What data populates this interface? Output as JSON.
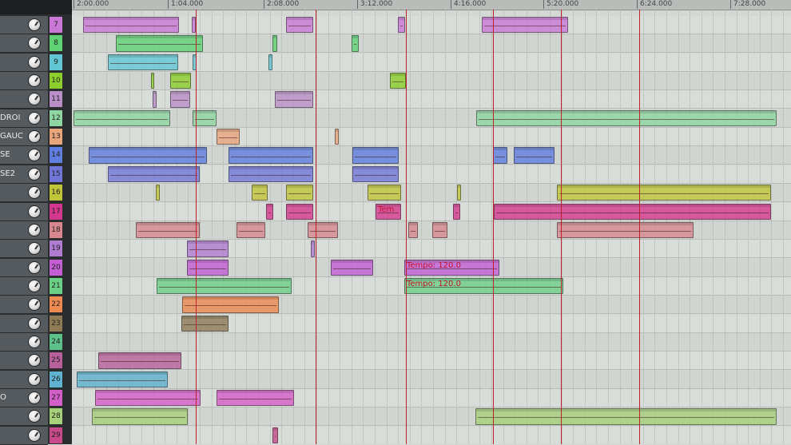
{
  "ruler": {
    "labels": [
      "2:00.000",
      "1:04.000",
      "2:08.000",
      "3:12.000",
      "4:16.000",
      "5:20.000",
      "6:24.000",
      "7:28.000"
    ]
  },
  "tracks": [
    {
      "num": "7",
      "name": "",
      "color": "#c978d6"
    },
    {
      "num": "8",
      "name": "",
      "color": "#5fd276"
    },
    {
      "num": "9",
      "name": "",
      "color": "#62c7d3"
    },
    {
      "num": "10",
      "name": "",
      "color": "#8ccf2a"
    },
    {
      "num": "11",
      "name": "",
      "color": "#b98ec8"
    },
    {
      "num": "12",
      "name": "DROI",
      "color": "#8ed7a2"
    },
    {
      "num": "13",
      "name": "GAUC",
      "color": "#e8a47a"
    },
    {
      "num": "14",
      "name": "SE",
      "color": "#5f7ee0"
    },
    {
      "num": "15",
      "name": "SE2",
      "color": "#6f76d8"
    },
    {
      "num": "16",
      "name": "",
      "color": "#c0c63a"
    },
    {
      "num": "17",
      "name": "",
      "color": "#d4388e"
    },
    {
      "num": "18",
      "name": "",
      "color": "#d7888e"
    },
    {
      "num": "19",
      "name": "",
      "color": "#b07cd2"
    },
    {
      "num": "20",
      "name": "",
      "color": "#c35ed4"
    },
    {
      "num": "21",
      "name": "",
      "color": "#6bcf86"
    },
    {
      "num": "22",
      "name": "",
      "color": "#ee8a52"
    },
    {
      "num": "23",
      "name": "",
      "color": "#8f7a56"
    },
    {
      "num": "24",
      "name": "",
      "color": "#5ec18a"
    },
    {
      "num": "25",
      "name": "",
      "color": "#b7609a"
    },
    {
      "num": "26",
      "name": "",
      "color": "#5fb3d0"
    },
    {
      "num": "27",
      "name": "O",
      "color": "#d45ec8"
    },
    {
      "num": "28",
      "name": "",
      "color": "#a6d07a"
    },
    {
      "num": "29",
      "name": "",
      "color": "#c84a8a"
    }
  ],
  "items": [
    {
      "row": 0,
      "start": 104,
      "end": 224,
      "label": ""
    },
    {
      "row": 0,
      "start": 240,
      "end": 245,
      "label": ""
    },
    {
      "row": 0,
      "start": 358,
      "end": 392,
      "label": ""
    },
    {
      "row": 0,
      "start": 498,
      "end": 507,
      "label": ""
    },
    {
      "row": 0,
      "start": 603,
      "end": 711,
      "label": ""
    },
    {
      "row": 1,
      "start": 145,
      "end": 254,
      "label": ""
    },
    {
      "row": 1,
      "start": 341,
      "end": 347,
      "label": ""
    },
    {
      "row": 1,
      "start": 440,
      "end": 449,
      "label": ""
    },
    {
      "row": 2,
      "start": 135,
      "end": 223,
      "label": ""
    },
    {
      "row": 2,
      "start": 241,
      "end": 246,
      "label": ""
    },
    {
      "row": 2,
      "start": 336,
      "end": 341,
      "label": ""
    },
    {
      "row": 3,
      "start": 189,
      "end": 193,
      "label": ""
    },
    {
      "row": 3,
      "start": 213,
      "end": 239,
      "label": ""
    },
    {
      "row": 3,
      "start": 488,
      "end": 508,
      "label": ""
    },
    {
      "row": 4,
      "start": 191,
      "end": 196,
      "label": ""
    },
    {
      "row": 4,
      "start": 213,
      "end": 238,
      "label": ""
    },
    {
      "row": 4,
      "start": 344,
      "end": 392,
      "label": ""
    },
    {
      "row": 5,
      "start": 92,
      "end": 213,
      "label": ""
    },
    {
      "row": 5,
      "start": 241,
      "end": 271,
      "label": ""
    },
    {
      "row": 5,
      "start": 596,
      "end": 972,
      "label": ""
    },
    {
      "row": 6,
      "start": 271,
      "end": 300,
      "label": ""
    },
    {
      "row": 6,
      "start": 419,
      "end": 424,
      "label": ""
    },
    {
      "row": 7,
      "start": 111,
      "end": 259,
      "label": ""
    },
    {
      "row": 7,
      "start": 286,
      "end": 392,
      "label": ""
    },
    {
      "row": 7,
      "start": 441,
      "end": 499,
      "label": ""
    },
    {
      "row": 7,
      "start": 617,
      "end": 635,
      "label": ""
    },
    {
      "row": 7,
      "start": 643,
      "end": 694,
      "label": ""
    },
    {
      "row": 8,
      "start": 135,
      "end": 250,
      "label": ""
    },
    {
      "row": 8,
      "start": 286,
      "end": 392,
      "label": ""
    },
    {
      "row": 8,
      "start": 441,
      "end": 499,
      "label": ""
    },
    {
      "row": 9,
      "start": 195,
      "end": 200,
      "label": ""
    },
    {
      "row": 9,
      "start": 315,
      "end": 335,
      "label": ""
    },
    {
      "row": 9,
      "start": 358,
      "end": 392,
      "label": ""
    },
    {
      "row": 9,
      "start": 460,
      "end": 502,
      "label": ""
    },
    {
      "row": 9,
      "start": 572,
      "end": 577,
      "label": ""
    },
    {
      "row": 9,
      "start": 697,
      "end": 965,
      "label": ""
    },
    {
      "row": 10,
      "start": 333,
      "end": 342,
      "label": ""
    },
    {
      "row": 10,
      "start": 358,
      "end": 392,
      "label": ""
    },
    {
      "row": 10,
      "start": 470,
      "end": 502,
      "label": "Tem"
    },
    {
      "row": 10,
      "start": 567,
      "end": 576,
      "label": ""
    },
    {
      "row": 10,
      "start": 618,
      "end": 965,
      "label": ""
    },
    {
      "row": 11,
      "start": 170,
      "end": 250,
      "label": ""
    },
    {
      "row": 11,
      "start": 296,
      "end": 332,
      "label": ""
    },
    {
      "row": 11,
      "start": 385,
      "end": 423,
      "label": ""
    },
    {
      "row": 11,
      "start": 511,
      "end": 523,
      "label": ""
    },
    {
      "row": 11,
      "start": 541,
      "end": 560,
      "label": ""
    },
    {
      "row": 11,
      "start": 697,
      "end": 868,
      "label": ""
    },
    {
      "row": 12,
      "start": 234,
      "end": 286,
      "label": ""
    },
    {
      "row": 12,
      "start": 389,
      "end": 394,
      "label": ""
    },
    {
      "row": 13,
      "start": 234,
      "end": 286,
      "label": ""
    },
    {
      "row": 13,
      "start": 414,
      "end": 467,
      "label": ""
    },
    {
      "row": 13,
      "start": 506,
      "end": 625,
      "label": "Tempo: 120.0"
    },
    {
      "row": 14,
      "start": 196,
      "end": 365,
      "label": ""
    },
    {
      "row": 14,
      "start": 506,
      "end": 705,
      "label": "Tempo: 120.0"
    },
    {
      "row": 15,
      "start": 228,
      "end": 349,
      "label": ""
    },
    {
      "row": 16,
      "start": 227,
      "end": 286,
      "label": ""
    },
    {
      "row": 18,
      "start": 123,
      "end": 227,
      "label": ""
    },
    {
      "row": 19,
      "start": 96,
      "end": 210,
      "label": ""
    },
    {
      "row": 20,
      "start": 119,
      "end": 251,
      "label": ""
    },
    {
      "row": 20,
      "start": 271,
      "end": 368,
      "label": ""
    },
    {
      "row": 21,
      "start": 115,
      "end": 235,
      "label": ""
    },
    {
      "row": 21,
      "start": 595,
      "end": 972,
      "label": ""
    },
    {
      "row": 22,
      "start": 341,
      "end": 348,
      "label": ""
    }
  ]
}
